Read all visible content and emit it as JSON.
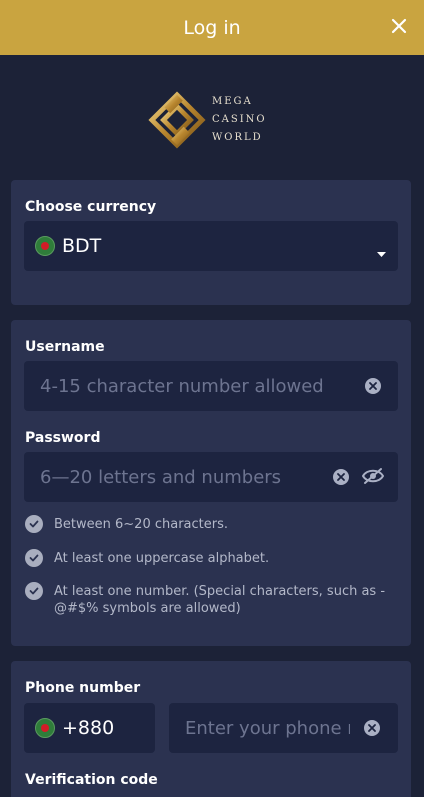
{
  "header": {
    "title": "Log in",
    "close_icon": "close-icon"
  },
  "logo": {
    "line1": "MEGA",
    "line2": "CASINO",
    "line3": "WORLD"
  },
  "currency": {
    "label": "Choose currency",
    "selected": "BDT",
    "flag_icon": "bangladesh-flag-icon",
    "dropdown_icon": "caret-down-icon"
  },
  "username": {
    "label": "Username",
    "placeholder": "4-15 character number allowed",
    "clear_icon": "clear-icon"
  },
  "password": {
    "label": "Password",
    "placeholder": "6—20 letters and numbers",
    "clear_icon": "clear-icon",
    "visibility_icon": "eye-off-icon",
    "rules": [
      "Between 6~20 characters.",
      "At least one uppercase alphabet.",
      "At least one number. (Special characters, such as -@#$% symbols are allowed)"
    ]
  },
  "phone": {
    "label": "Phone number",
    "country_code": "+880",
    "placeholder": "Enter your phone number",
    "clear_icon": "clear-icon"
  },
  "verification": {
    "label": "Verification code"
  },
  "colors": {
    "header_bg": "#c9a440",
    "page_bg": "#1c2237",
    "card_bg": "#2b3250",
    "field_bg": "#1d2440"
  }
}
